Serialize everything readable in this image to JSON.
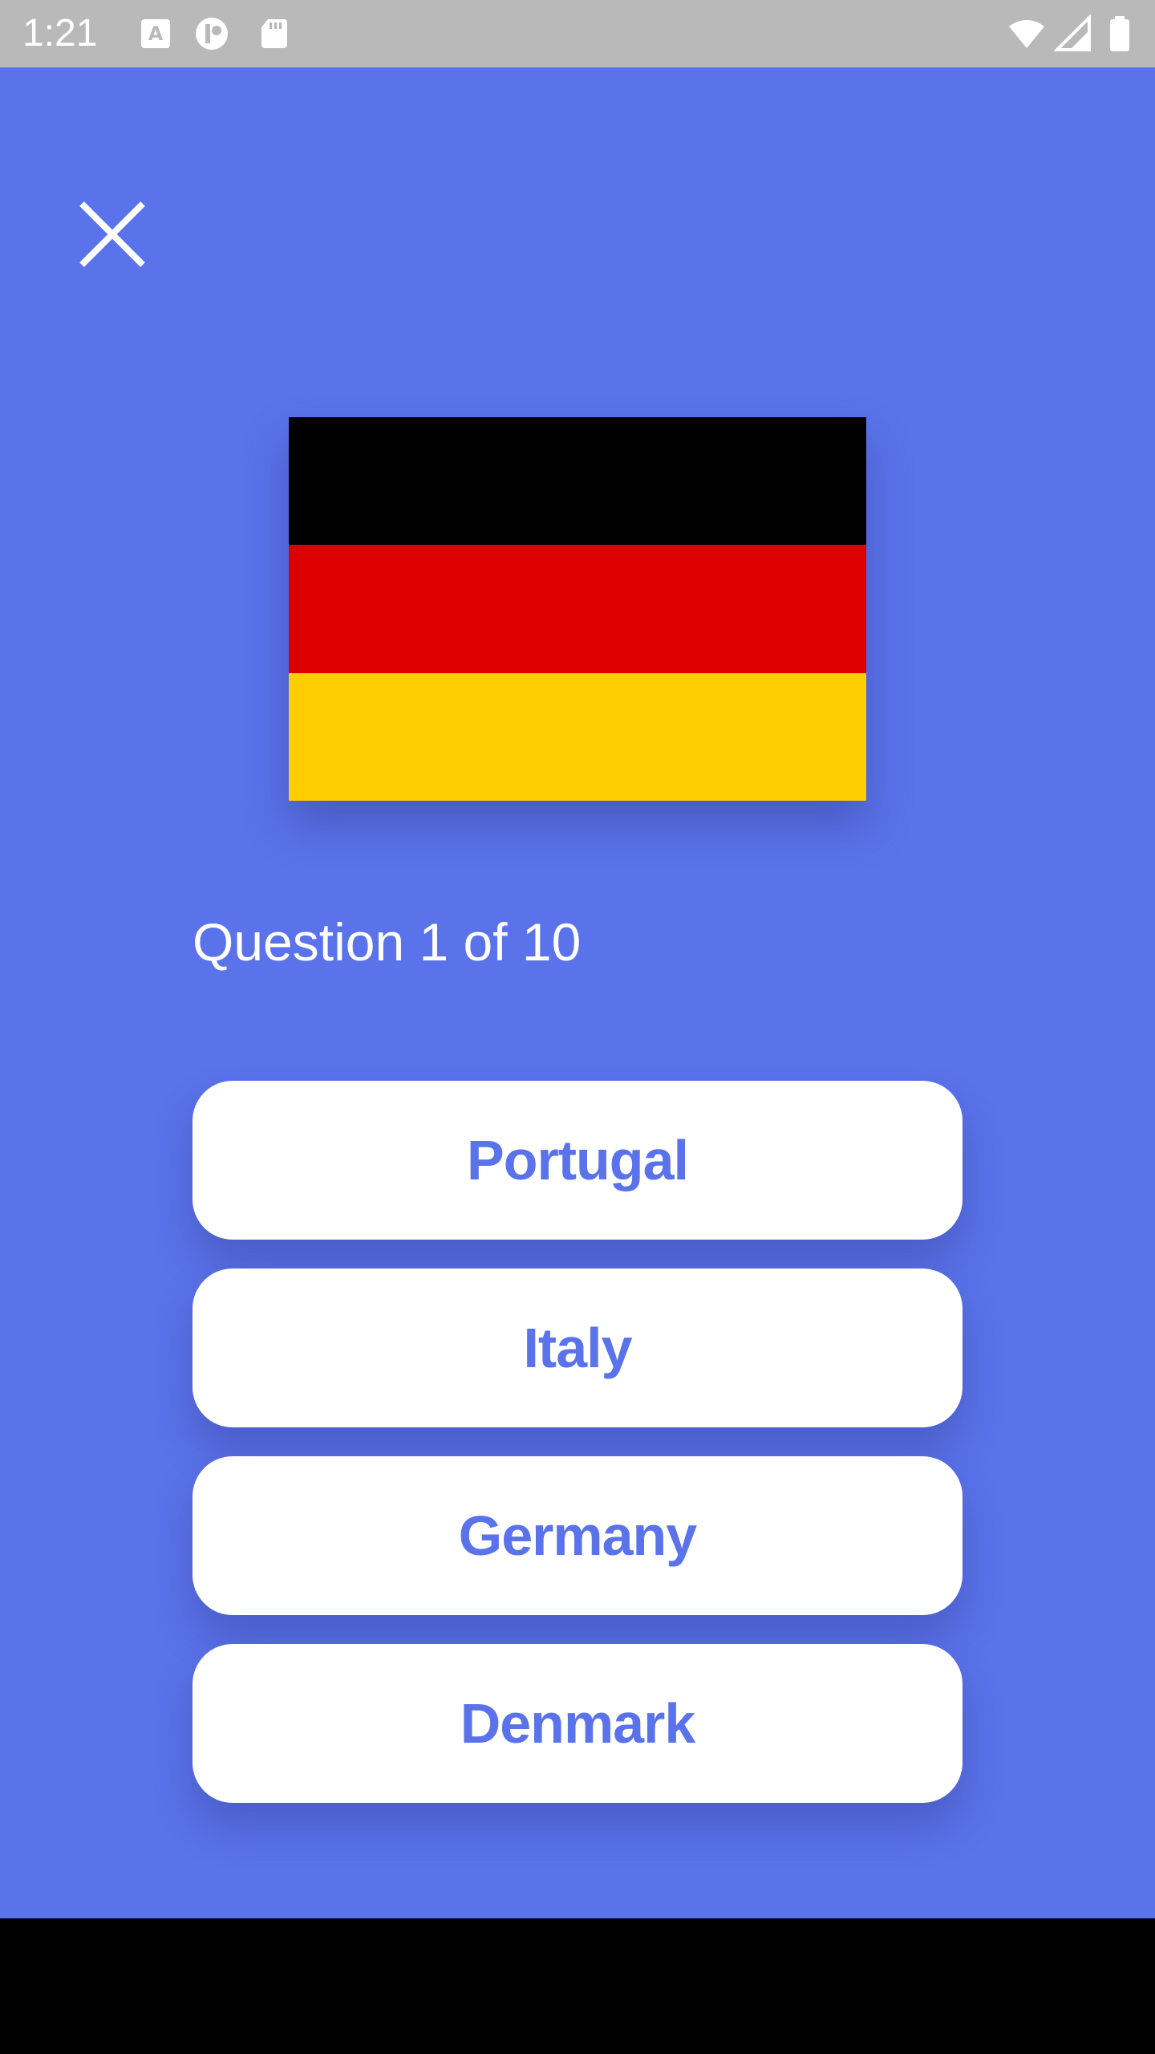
{
  "status_bar": {
    "time": "1:21",
    "icons": [
      "a-notification-icon",
      "app-notification-icon",
      "sd-card-icon",
      "wifi-icon",
      "signal-icon",
      "battery-icon"
    ]
  },
  "header": {
    "close_icon": "close-icon"
  },
  "flag": {
    "country_shown": "flag-image",
    "colors": [
      "#000000",
      "#dd0000",
      "#ffce00"
    ]
  },
  "quiz": {
    "question_text": "Question 1 of 10"
  },
  "answers": [
    {
      "label": "Portugal"
    },
    {
      "label": "Italy"
    },
    {
      "label": "Germany"
    },
    {
      "label": "Denmark"
    }
  ],
  "theme": {
    "background": "#5a72ea",
    "status_bar": "#b9b9b9",
    "button_bg": "#ffffff",
    "button_text": "#5a72ea"
  }
}
